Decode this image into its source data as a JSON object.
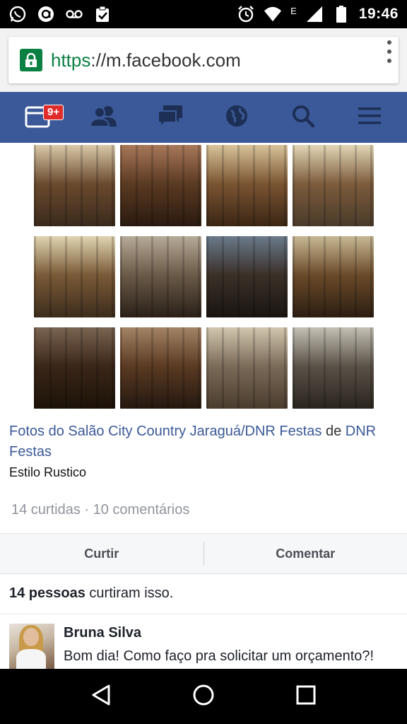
{
  "status_bar": {
    "time": "19:46",
    "network_label": "E",
    "left_icons": [
      "whatsapp-icon",
      "app-notification-icon",
      "voicemail-icon",
      "clipboard-check-icon"
    ],
    "right_icons": [
      "alarm-icon",
      "wifi-icon",
      "signal-icon",
      "battery-icon"
    ]
  },
  "browser": {
    "url_scheme": "https",
    "url_rest": "://m.facebook.com"
  },
  "fb_nav": {
    "notification_badge": "9+",
    "items": [
      "feed-icon",
      "friends-icon",
      "messages-icon",
      "globe-icon",
      "search-icon",
      "menu-icon"
    ],
    "color": "#3b5998"
  },
  "photos": [
    {
      "colors": [
        "#d9c9a9",
        "#6b4a2e",
        "#3a2a1c"
      ]
    },
    {
      "colors": [
        "#a8785a",
        "#5a3a22",
        "#2a1a10"
      ]
    },
    {
      "colors": [
        "#d8c49a",
        "#7a5432",
        "#3a2614"
      ]
    },
    {
      "colors": [
        "#e2d6b6",
        "#7c5c3c",
        "#4a3a2a"
      ]
    },
    {
      "colors": [
        "#e0d4b0",
        "#7a5a38",
        "#3c2c1c"
      ]
    },
    {
      "colors": [
        "#b8aa98",
        "#6a5a48",
        "#2a2018"
      ]
    },
    {
      "colors": [
        "#6a7a8a",
        "#3a3028",
        "#1a1410"
      ]
    },
    {
      "colors": [
        "#c8b894",
        "#6a4a2a",
        "#2c1e12"
      ]
    },
    {
      "colors": [
        "#7a6452",
        "#3a2618",
        "#1c1208"
      ]
    },
    {
      "colors": [
        "#a48466",
        "#5a3a22",
        "#241810"
      ]
    },
    {
      "colors": [
        "#d2c6ae",
        "#7a6a58",
        "#4a3c2e"
      ]
    },
    {
      "colors": [
        "#c4c0b4",
        "#5a5248",
        "#2a241e"
      ]
    }
  ],
  "post": {
    "title_link": "Fotos do Salão City Country Jaraguá/DNR Festas",
    "title_connector": " de ",
    "title_author": "DNR Festas",
    "caption": "Estilo Rustico",
    "stats": "14 curtidas · 10 comentários"
  },
  "actions": {
    "like_label": "Curtir",
    "comment_label": "Comentar"
  },
  "likes_summary": {
    "bold": "14 pessoas",
    "rest": " curtiram isso."
  },
  "comment": {
    "author": "Bruna Silva",
    "text": "Bom dia! Como faço pra solicitar um orçamento?! Obrigada"
  }
}
